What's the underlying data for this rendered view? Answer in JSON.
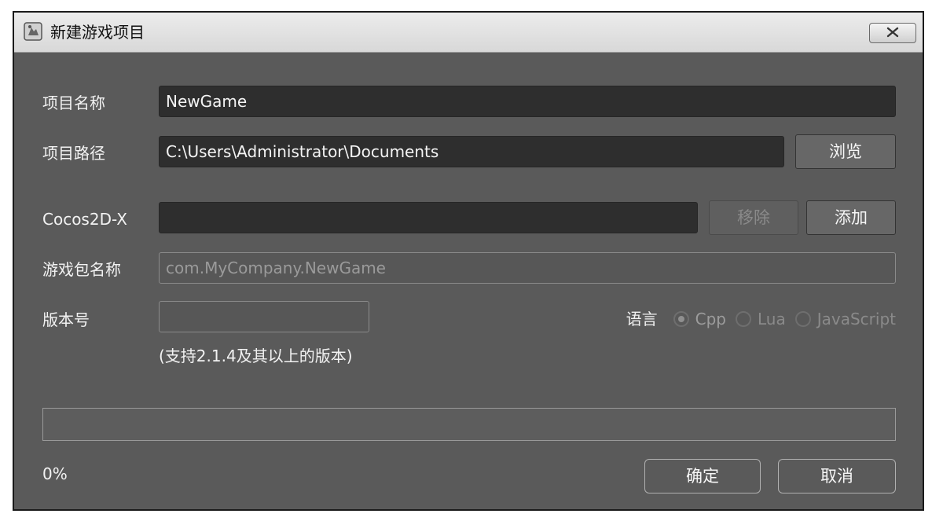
{
  "window": {
    "title": "新建游戏项目",
    "icon": "cocos-app-icon",
    "close_icon": "close-icon"
  },
  "form": {
    "project_name_label": "项目名称",
    "project_name_value": "NewGame",
    "project_path_label": "项目路径",
    "project_path_value": "C:\\Users\\Administrator\\Documents",
    "browse_label": "浏览",
    "cocos_label": "Cocos2D-X",
    "cocos_value": "",
    "remove_label": "移除",
    "add_label": "添加",
    "package_label": "游戏包名称",
    "package_placeholder": "com.MyCompany.NewGame",
    "version_label": "版本号",
    "version_value": "",
    "version_hint": "(支持2.1.4及其以上的版本)",
    "language_label": "语言",
    "languages": [
      {
        "label": "Cpp",
        "selected": true
      },
      {
        "label": "Lua",
        "selected": false
      },
      {
        "label": "JavaScript",
        "selected": false
      }
    ]
  },
  "progress": {
    "value": 0,
    "text": "0%"
  },
  "footer": {
    "ok_label": "确定",
    "cancel_label": "取消"
  }
}
